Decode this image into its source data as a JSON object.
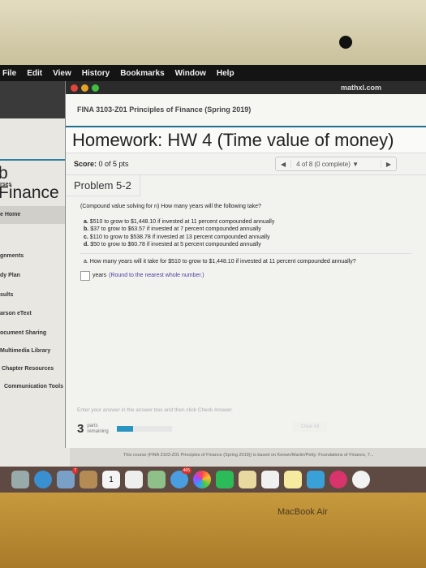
{
  "menubar": {
    "items": [
      "File",
      "Edit",
      "View",
      "History",
      "Bookmarks",
      "Window",
      "Help"
    ]
  },
  "browser": {
    "url": "mathxl.com"
  },
  "background_window": {
    "title": "b Finance",
    "sidebar": [
      "rses",
      "e Home",
      "gnments",
      "dy Plan",
      "sults",
      "arson eText",
      "ocument Sharing",
      "Multimedia Library",
      "Chapter Resources",
      "Communication Tools"
    ]
  },
  "page": {
    "course": "FINA 3103-Z01 Principles of Finance (Spring 2019)",
    "title": "Homework: HW 4 (Time value of money)",
    "score_label": "Score:",
    "score_value": "0 of 5 pts",
    "nav": {
      "prev": "◀",
      "status": "4 of 8 (0 complete) ▼",
      "next": "▶"
    },
    "problem": "Problem 5-2",
    "question": "(Compound value solving for n) How many years will the following take?",
    "items": [
      {
        "letter": "a.",
        "text": "$510 to grow to $1,448.10 if invested at 11 percent compounded annually"
      },
      {
        "letter": "b.",
        "text": "$37 to grow to $63.57 if invested at 7 percent compounded annually"
      },
      {
        "letter": "c.",
        "text": "$110 to grow to $538.78 if invested at 13 percent compounded annually"
      },
      {
        "letter": "d.",
        "text": "$50 to grow to $60.78 if invested at 5 percent compounded annually"
      }
    ],
    "part_a": "a. How many years will it take for $510 to grow to $1,448.10 if invested at 11 percent compounded annually?",
    "answer": {
      "value": "",
      "unit": "years",
      "hint": "(Round to the nearest whole number.)"
    },
    "instruction": "Enter your answer in the answer box and then click Check Answer.",
    "parts_count": "3",
    "parts_label1": "parts",
    "parts_label2": "remaining",
    "progress_fraction": 0.3,
    "clear_all": "Clear All",
    "course_note": "This course (FINA 3103-Z01 Principles of Finance (Spring 2019)) is based on Keown/Martin/Petty: Foundations of Finance, 7..."
  },
  "dock": {
    "mail_badge": "7",
    "messages_badge": "465",
    "calendar_day": "1"
  },
  "laptop": {
    "brand": "MacBook Air"
  },
  "colors": {
    "accent": "#1f6f8f",
    "progress": "#2b93c0",
    "hint": "#4a3fa0"
  }
}
